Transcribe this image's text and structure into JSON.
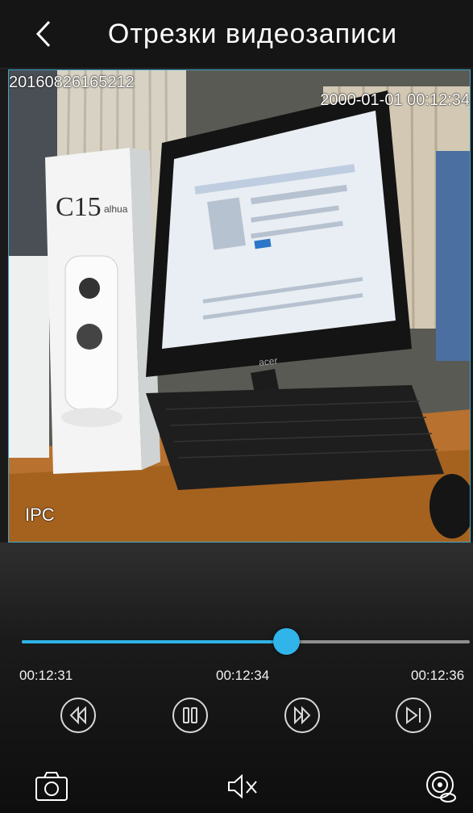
{
  "header": {
    "title": "Отрезки видеозаписи",
    "back_icon": "chevron-left-icon"
  },
  "video": {
    "osd_top_left": "20160826165212",
    "osd_top_right": "2000-01-01 00:12:34",
    "osd_bottom_left": "IPC"
  },
  "playback": {
    "progress": 0.59,
    "start_time": "00:12:31",
    "current_time": "00:12:34",
    "end_time": "00:12:36"
  },
  "colors": {
    "accent": "#2fb3e6",
    "background": "#1a1a1a"
  },
  "controls": [
    "rewind-icon",
    "pause-icon",
    "fast-forward-icon",
    "step-forward-icon"
  ],
  "toolbar": [
    "camera-icon",
    "mute-icon",
    "record-icon"
  ]
}
